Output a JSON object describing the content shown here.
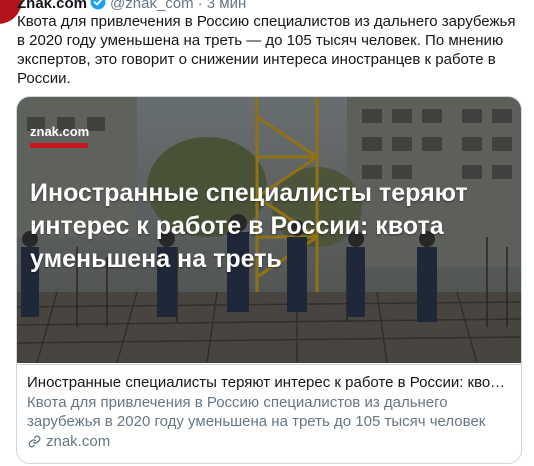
{
  "tweet": {
    "author_name": "Znak.com",
    "handle": "@znak_com",
    "time": "· 3 мин",
    "text": "Квота для привлечения в Россию специалистов из дальнего зарубежья в 2020 году уменьшена на треть — до 105 тысяч человек. По мнению экспертов, это говорит о снижении интереса иностранцев к работе в России."
  },
  "card": {
    "logo": "znak.com",
    "headline": "Иностранные специалисты теряют интерес к работе в России: квота уменьшена на треть",
    "title": "Иностранные специалисты теряют интерес к работе в России: квота...",
    "description": "Квота для привлечения в Россию специалистов из дальнего зарубежья в 2020 году уменьшена на треть до 105 тысяч человек",
    "domain": "znak.com"
  },
  "icons": {
    "verified": "verified-badge-icon",
    "link": "link-icon"
  },
  "colors": {
    "brand_red": "#c4161c",
    "verified_blue": "#1da1f2",
    "muted": "#657786"
  }
}
